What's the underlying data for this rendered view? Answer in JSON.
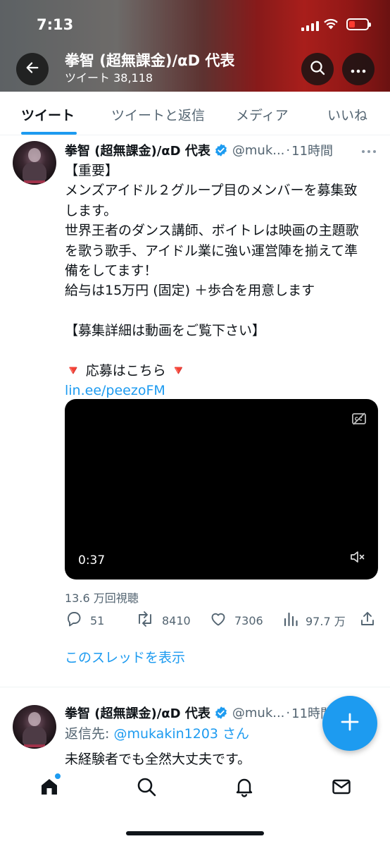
{
  "status_bar": {
    "time": "7:13"
  },
  "header": {
    "name": "拳智 (超無課金)/αD 代表",
    "tweet_count_label": "ツイート 38,118"
  },
  "tabs": [
    {
      "label": "ツイート",
      "active": true
    },
    {
      "label": "ツイートと返信",
      "active": false
    },
    {
      "label": "メディア",
      "active": false
    },
    {
      "label": "いいね",
      "active": false
    }
  ],
  "tweet": {
    "name": "拳智 (超無課金)/αD 代表",
    "handle": "@muk...",
    "separator": "·",
    "time": "11時間",
    "body_lines": [
      "【重要】",
      "メンズアイドル２グループ目のメンバーを募集致",
      "します。",
      "世界王者のダンス講師、ボイトレは映画の主題歌",
      "を歌う歌手、アイドル業に強い運営陣を揃えて準",
      "備をしてます！",
      "給与は15万円 (固定) ＋歩合を用意します",
      "",
      "【募集詳細は動画をご覧下さい】",
      "",
      "🔻 応募はこちら 🔻"
    ],
    "link": "lin.ee/peezoFM",
    "video": {
      "duration": "0:37"
    },
    "views": "13.6 万回視聴",
    "stats": {
      "replies": "51",
      "retweets": "8410",
      "likes": "7306",
      "analytics": "97.7 万"
    },
    "show_thread": "このスレッドを表示"
  },
  "tweet2": {
    "name": "拳智 (超無課金)/αD 代表",
    "handle": "@muk...",
    "separator": "·",
    "time": "11時間",
    "reply_prefix": "返信先: ",
    "reply_mention": "@mukakin1203",
    "reply_suffix": " さん",
    "body": "未経験者でも全然大丈夫です。"
  },
  "colors": {
    "accent": "#1d9bf0",
    "text": "#0f1419",
    "secondary": "#536471"
  },
  "icons": [
    "back-arrow-icon",
    "search-icon",
    "more-icon",
    "verified-icon",
    "captions-icon",
    "mute-icon",
    "reply-icon",
    "retweet-icon",
    "like-icon",
    "analytics-icon",
    "share-icon",
    "compose-plus-icon",
    "home-icon",
    "explore-search-icon",
    "notifications-bell-icon",
    "messages-envelope-icon"
  ]
}
